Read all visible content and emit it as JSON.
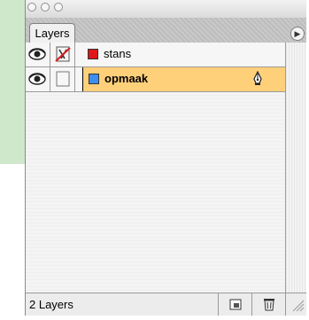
{
  "panel": {
    "tab_label": "Layers",
    "menu_icon": "panel-menu-arrow-icon"
  },
  "layers": [
    {
      "name": "stans",
      "color": "#e01818",
      "visible": true,
      "locked": true,
      "selected": false
    },
    {
      "name": "opmaak",
      "color": "#3d8ef0",
      "visible": true,
      "locked": false,
      "selected": true
    }
  ],
  "status": {
    "count_text": "2 Layers"
  },
  "icons": {
    "eye": "eye-icon",
    "lock": "lock-crossed-icon",
    "pen": "pen-icon",
    "new_layer": "new-layer-icon",
    "delete": "trash-icon",
    "resize": "resize-grip-icon"
  }
}
